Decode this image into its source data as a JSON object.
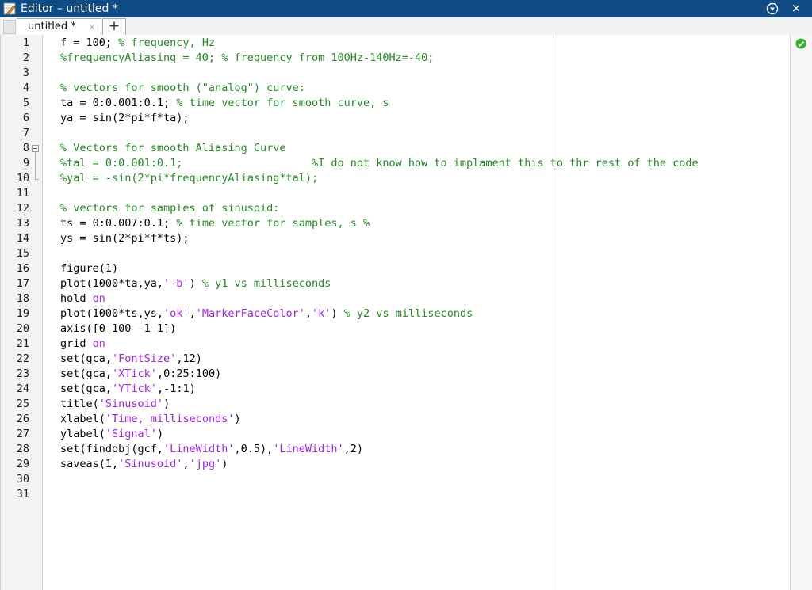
{
  "window": {
    "title": "Editor – untitled *",
    "menu_icon": "circle-chevron-down-icon",
    "close_label": "×"
  },
  "tabs": [
    {
      "label": "untitled *",
      "close": "×"
    }
  ],
  "new_tab_label": "+",
  "code_analyzer_status": "check-circle-icon",
  "colors": {
    "titlebar": "#0f4c85",
    "comment": "#228b22",
    "string_keyword": "#a020f0",
    "ok": "#2fb52b"
  },
  "editor": {
    "fold_line": 8,
    "lines": [
      [
        [
          "c",
          "f = 100; "
        ],
        [
          "m",
          "% frequency, Hz"
        ]
      ],
      [
        [
          "m",
          "%frequencyAliasing = 40; % frequency from 100Hz-140Hz=-40;"
        ]
      ],
      [],
      [
        [
          "m",
          "% vectors for smooth (\"analog\") curve:"
        ]
      ],
      [
        [
          "c",
          "ta = 0:0.001:0.1; "
        ],
        [
          "m",
          "% time vector for smooth curve, s"
        ]
      ],
      [
        [
          "c",
          "ya = sin(2*pi*f*ta);"
        ]
      ],
      [],
      [
        [
          "m",
          "% Vectors for smooth Aliasing Curve"
        ]
      ],
      [
        [
          "m",
          "%tal = 0:0.001:0.1;                    %I do not know how to implament this to thr rest of the code"
        ]
      ],
      [
        [
          "m",
          "%yal = -sin(2*pi*frequencyAliasing*tal);"
        ]
      ],
      [],
      [
        [
          "m",
          "% vectors for samples of sinusoid:"
        ]
      ],
      [
        [
          "c",
          "ts = 0:0.007:0.1; "
        ],
        [
          "m",
          "% time vector for samples, s %"
        ]
      ],
      [
        [
          "c",
          "ys = sin(2*pi*f*ts);"
        ]
      ],
      [],
      [
        [
          "c",
          "figure(1)"
        ]
      ],
      [
        [
          "c",
          "plot(1000*ta,ya,"
        ],
        [
          "s",
          "'-b'"
        ],
        [
          "c",
          ") "
        ],
        [
          "m",
          "% y1 vs milliseconds"
        ]
      ],
      [
        [
          "c",
          "hold "
        ],
        [
          "k",
          "on"
        ]
      ],
      [
        [
          "c",
          "plot(1000*ts,ys,"
        ],
        [
          "s",
          "'ok'"
        ],
        [
          "c",
          ","
        ],
        [
          "s",
          "'MarkerFaceColor'"
        ],
        [
          "c",
          ","
        ],
        [
          "s",
          "'k'"
        ],
        [
          "c",
          ") "
        ],
        [
          "m",
          "% y2 vs milliseconds"
        ]
      ],
      [
        [
          "c",
          "axis([0 100 -1 1])"
        ]
      ],
      [
        [
          "c",
          "grid "
        ],
        [
          "k",
          "on"
        ]
      ],
      [
        [
          "c",
          "set(gca,"
        ],
        [
          "s",
          "'FontSize'"
        ],
        [
          "c",
          ",12)"
        ]
      ],
      [
        [
          "c",
          "set(gca,"
        ],
        [
          "s",
          "'XTick'"
        ],
        [
          "c",
          ",0:25:100)"
        ]
      ],
      [
        [
          "c",
          "set(gca,"
        ],
        [
          "s",
          "'YTick'"
        ],
        [
          "c",
          ",-1:1)"
        ]
      ],
      [
        [
          "c",
          "title("
        ],
        [
          "s",
          "'Sinusoid'"
        ],
        [
          "c",
          ")"
        ]
      ],
      [
        [
          "c",
          "xlabel("
        ],
        [
          "s",
          "'Time, milliseconds'"
        ],
        [
          "c",
          ")"
        ]
      ],
      [
        [
          "c",
          "ylabel("
        ],
        [
          "s",
          "'Signal'"
        ],
        [
          "c",
          ")"
        ]
      ],
      [
        [
          "c",
          "set(findobj(gcf,"
        ],
        [
          "s",
          "'LineWidth'"
        ],
        [
          "c",
          ",0.5),"
        ],
        [
          "s",
          "'LineWidth'"
        ],
        [
          "c",
          ",2)"
        ]
      ],
      [
        [
          "c",
          "saveas(1,"
        ],
        [
          "s",
          "'Sinusoid'"
        ],
        [
          "c",
          ","
        ],
        [
          "s",
          "'jpg'"
        ],
        [
          "c",
          ")"
        ]
      ],
      [],
      []
    ]
  }
}
